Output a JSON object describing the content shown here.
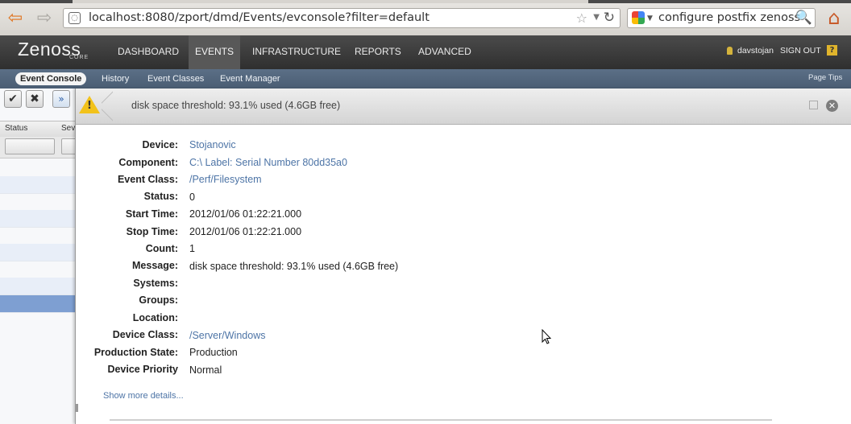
{
  "browser": {
    "back_icon": "back-arrow-icon",
    "forward_icon": "forward-arrow-icon",
    "url": "localhost:8080/zport/dmd/Events/evconsole?filter=default",
    "search_value": "configure postfix zenoss",
    "reload_glyph": "↻",
    "star_glyph": "☆",
    "search_glyph": "🔍",
    "home_glyph": "⌂",
    "back_glyph": "⇦",
    "fwd_glyph": "⇨"
  },
  "app": {
    "logo": "Zenoss",
    "logo_sub": "CORE",
    "nav": [
      {
        "label": "DASHBOARD"
      },
      {
        "label": "EVENTS"
      },
      {
        "label": "INFRASTRUCTURE"
      },
      {
        "label": "REPORTS"
      },
      {
        "label": "ADVANCED"
      }
    ],
    "active_nav": "EVENTS",
    "user": "davstojan",
    "sign_out": "SIGN OUT",
    "help_glyph": "?"
  },
  "subnav": {
    "items": [
      {
        "label": "Event Console"
      },
      {
        "label": "History"
      },
      {
        "label": "Event Classes"
      },
      {
        "label": "Event Manager"
      }
    ],
    "active": "Event Console",
    "page_tips": "Page Tips"
  },
  "grid": {
    "toolbar": {
      "ack_glyph": "✔",
      "close_glyph": "✖",
      "more_glyph": "»"
    },
    "columns": [
      "Status",
      "Sev"
    ]
  },
  "detail": {
    "summary": "disk space threshold: 93.1% used (4.6GB free)",
    "severity_icon": "warning-icon",
    "warn_glyph": "!",
    "close_glyph": "✕",
    "fields": [
      {
        "label": "Device:",
        "value": "Stojanovic"
      },
      {
        "label": "Component:",
        "value": "C:\\ Label: Serial Number 80dd35a0"
      },
      {
        "label": "Event Class:",
        "value": "/Perf/Filesystem"
      },
      {
        "label": "Status:",
        "value": "0"
      },
      {
        "label": "Start Time:",
        "value": "2012/01/06 01:22:21.000"
      },
      {
        "label": "Stop Time:",
        "value": "2012/01/06 01:22:21.000"
      },
      {
        "label": "Count:",
        "value": "1"
      },
      {
        "label": "Message:",
        "value": "disk space threshold: 93.1% used (4.6GB free)"
      },
      {
        "label": "Systems:",
        "value": ""
      },
      {
        "label": "Groups:",
        "value": ""
      },
      {
        "label": "Location:",
        "value": ""
      },
      {
        "label": "Device Class:",
        "value": "/Server/Windows"
      },
      {
        "label": "Production State:",
        "value": "Production"
      },
      {
        "label": "Device Priority",
        "value": "Normal"
      }
    ],
    "more_details": "Show more details..."
  },
  "colors": {
    "link": "#4d74a6",
    "header_dark": "#3a3a3a",
    "subnav_blue": "#526680",
    "warning": "#f2c21a"
  }
}
